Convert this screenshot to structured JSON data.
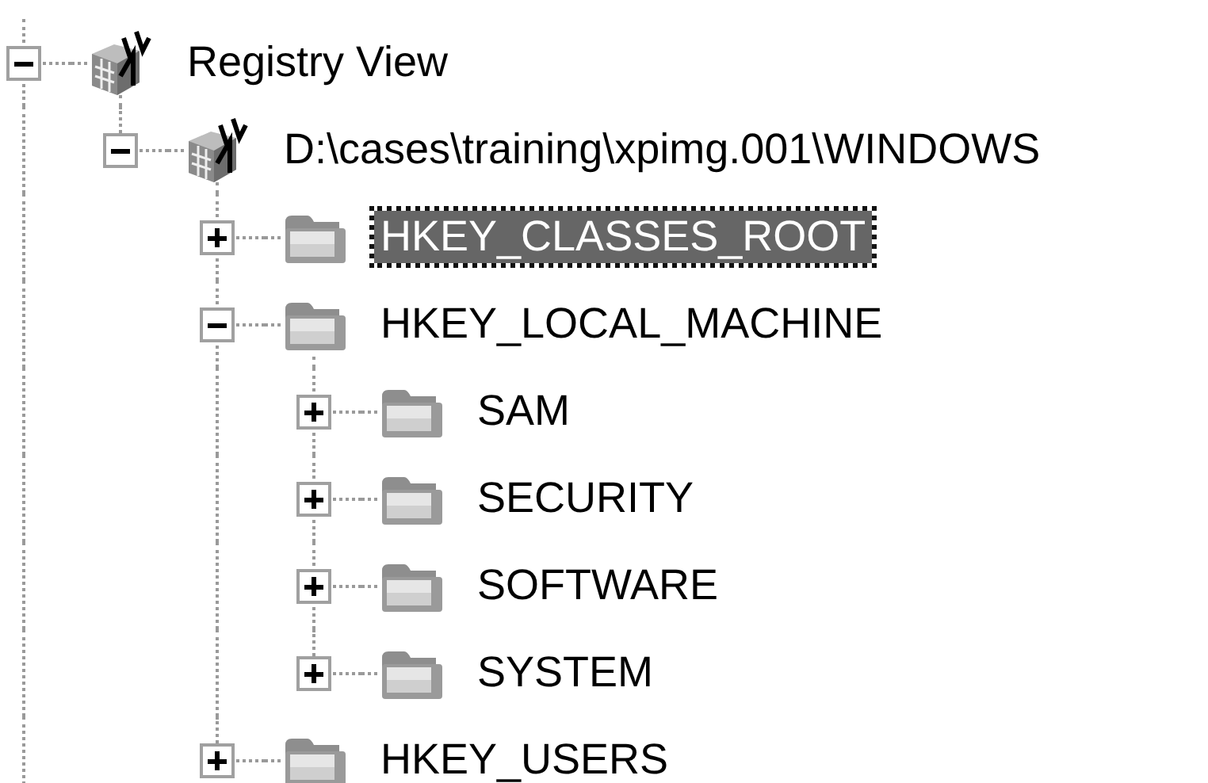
{
  "tree": [
    {
      "label": "Registry View",
      "kind": "registry",
      "expanded": true,
      "selected": false,
      "children": [
        {
          "label": "D:\\cases\\training\\xpimg.001\\WINDOWS",
          "kind": "registry",
          "expanded": true,
          "selected": false,
          "children": [
            {
              "label": "HKEY_CLASSES_ROOT",
              "kind": "folder",
              "expanded": false,
              "selected": true
            },
            {
              "label": "HKEY_LOCAL_MACHINE",
              "kind": "folder",
              "expanded": true,
              "selected": false,
              "children": [
                {
                  "label": "SAM",
                  "kind": "folder",
                  "expanded": false,
                  "selected": false
                },
                {
                  "label": "SECURITY",
                  "kind": "folder",
                  "expanded": false,
                  "selected": false
                },
                {
                  "label": "SOFTWARE",
                  "kind": "folder",
                  "expanded": false,
                  "selected": false
                },
                {
                  "label": "SYSTEM",
                  "kind": "folder",
                  "expanded": false,
                  "selected": false
                }
              ]
            },
            {
              "label": "HKEY_USERS",
              "kind": "folder",
              "expanded": false,
              "selected": false
            }
          ]
        }
      ]
    }
  ]
}
